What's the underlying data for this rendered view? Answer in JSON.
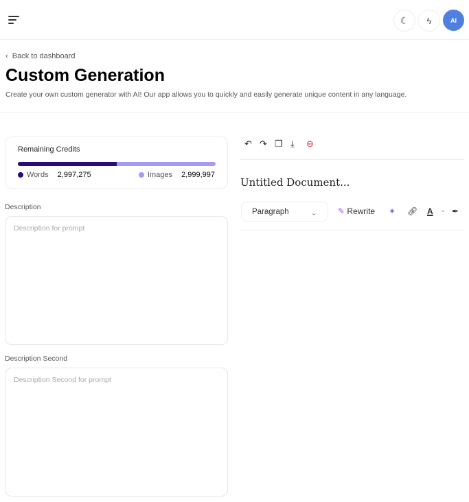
{
  "header": {
    "avatar_text": "AI"
  },
  "back_label": "Back to dashboard",
  "title": "Custom Generation",
  "subtitle": "Create your own custom generator with AI! Our app allows you to quickly and easily generate unique content in any language.",
  "credits": {
    "title": "Remaining Credits",
    "words_label": "Words",
    "words_value": "2,997,275",
    "images_label": "Images",
    "images_value": "2,999,997",
    "words_fraction": 0.5,
    "colors": {
      "words": "#2e0a78",
      "images": "#a49cf3"
    }
  },
  "fields": [
    {
      "label": "Description",
      "placeholder": "Description for prompt"
    },
    {
      "label": "Description Second",
      "placeholder": "Description Second for prompt"
    }
  ],
  "editor": {
    "doc_title": "Untitled Document...",
    "block_type": "Paragraph",
    "rewrite_label": "Rewrite",
    "font_color_label": "A"
  }
}
